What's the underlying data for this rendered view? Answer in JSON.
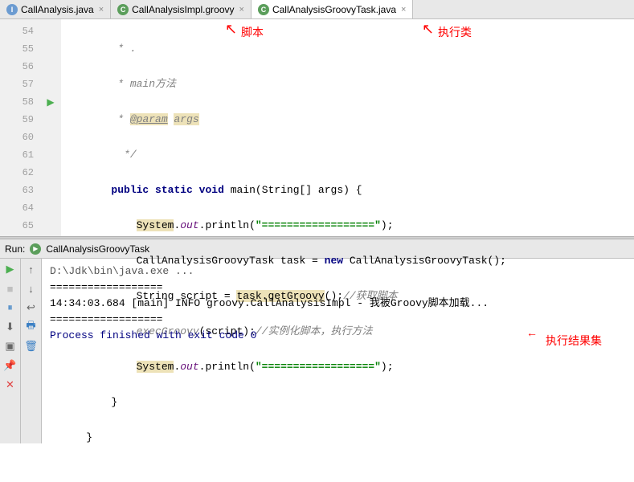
{
  "tabs": [
    {
      "icon": "I",
      "iconClass": "icon-i",
      "label": "CallAnalysis.java",
      "close": "×"
    },
    {
      "icon": "C",
      "iconClass": "icon-c",
      "label": "CallAnalysisImpl.groovy",
      "close": "×"
    },
    {
      "icon": "C",
      "iconClass": "icon-c",
      "label": "CallAnalysisGroovyTask.java",
      "close": "×"
    }
  ],
  "annotations": {
    "top1": "脚本",
    "top2": "执行类",
    "result": "执行结果集"
  },
  "gutter": {
    "lines": [
      "54",
      "55",
      "56",
      "57",
      "58",
      "59",
      "60",
      "61",
      "62",
      "63",
      "64",
      "65"
    ]
  },
  "code": {
    "l54": " .",
    "l55a": " main",
    "l55b": "方法",
    "l56a": " ",
    "l56b": "@param",
    "l56c": " ",
    "l56d": "args",
    "l57": " */",
    "l58a": "public",
    "l58b": "static",
    "l58c": "void",
    "l58d": " main(String[] args) {",
    "l59a": "System",
    "l59b": ".",
    "l59c": "out",
    "l59d": ".println(",
    "l59e": "\"==================\"",
    "l59f": ");",
    "l60a": "CallAnalysisGroovyTask task = ",
    "l60b": "new",
    "l60c": " CallAnalysisGroovyTask();",
    "l61a": "String script = ",
    "l61b": "task.getGroovy",
    "l61c": "();",
    "l61d": "//获取脚本",
    "l62a": "execGroovy",
    "l62b": "(script);",
    "l62c": "//实例化脚本，执行方法",
    "l63a": "System",
    "l63b": ".",
    "l63c": "out",
    "l63d": ".println(",
    "l63e": "\"==================\"",
    "l63f": ");",
    "l64": "}",
    "l65": "}"
  },
  "run": {
    "label": "Run:",
    "config": "CallAnalysisGroovyTask"
  },
  "console": {
    "path": "D:\\Jdk\\bin\\java.exe ...",
    "eq1": "==================",
    "log": "14:34:03.684 [main] INFO groovy.CallAnalysisImpl - 我被Groovy脚本加载...",
    "eq2": "==================",
    "blank": "",
    "exit": "Process finished with exit code 0"
  }
}
